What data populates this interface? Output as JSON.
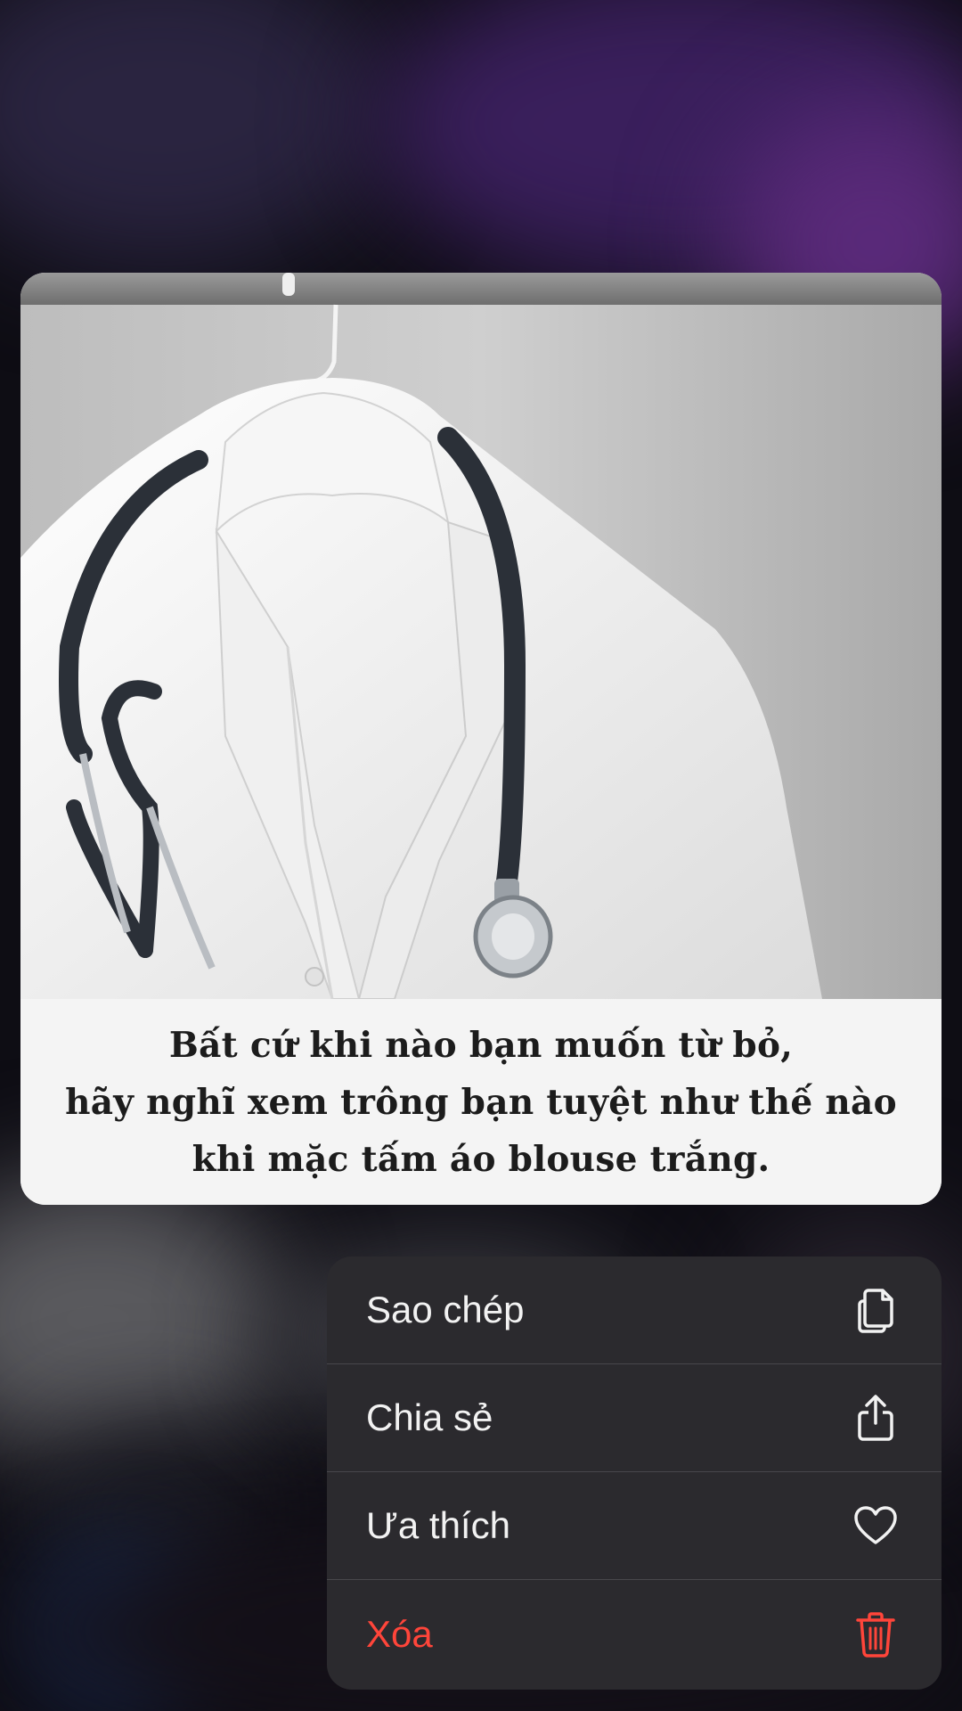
{
  "preview": {
    "caption_lines": [
      "Bất cứ khi nào bạn muốn từ bỏ,",
      "hãy nghĩ xem trông bạn tuyệt như thế nào",
      "khi mặc tấm áo blouse trắng."
    ]
  },
  "menu": {
    "items": [
      {
        "label": "Sao chép",
        "icon": "copy-icon"
      },
      {
        "label": "Chia sẻ",
        "icon": "share-icon"
      },
      {
        "label": "Ưa thích",
        "icon": "heart-icon"
      },
      {
        "label": "Xóa",
        "icon": "trash-icon"
      }
    ],
    "danger_color": "#ff453a"
  }
}
